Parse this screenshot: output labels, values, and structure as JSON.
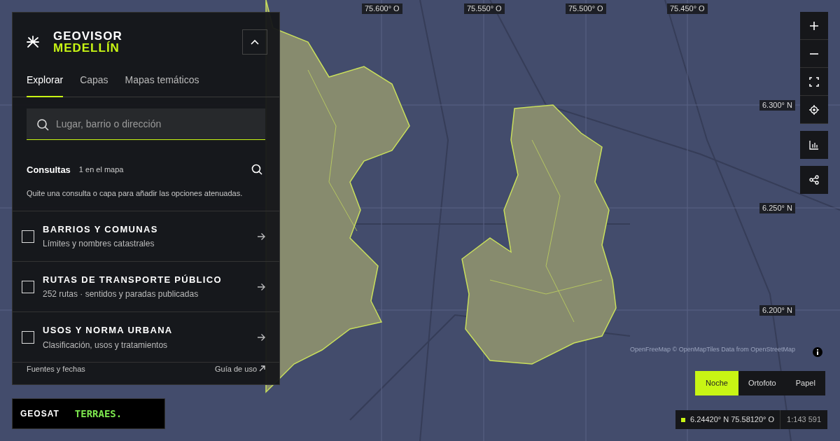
{
  "brand": {
    "title": "GEOVISOR",
    "subtitle": "MEDELLÍN"
  },
  "tabs": [
    {
      "label": "Explorar",
      "selected": true
    },
    {
      "label": "Capas",
      "selected": false
    },
    {
      "label": "Mapas temáticos",
      "selected": false
    }
  ],
  "search": {
    "placeholder": "Lugar, barrio o dirección"
  },
  "queries": {
    "title": "Consultas",
    "count": "1 en el mapa",
    "hint": "Quite una consulta o capa para añadir las opciones atenuadas."
  },
  "layers": [
    {
      "title": "BARRIOS Y COMUNAS",
      "description": "Límites y nombres catastrales",
      "checked": false
    },
    {
      "title": "RUTAS DE TRANSPORTE PÚBLICO",
      "description": "252 rutas · sentidos y paradas publicadas",
      "checked": false
    },
    {
      "title": "USOS Y NORMA URBANA",
      "description": "Clasificación, usos y tratamientos",
      "checked": false
    }
  ],
  "footer": {
    "sources": "Fuentes y fechas",
    "guide": "Guía de uso"
  },
  "partners": [
    "GEOSAT",
    "TERRAES."
  ],
  "map": {
    "longitude_labels": [
      "75.600° O",
      "75.550° O",
      "75.500° O",
      "75.450° O"
    ],
    "latitude_labels": [
      "6.300° N",
      "6.250° N",
      "6.200° N"
    ],
    "attribution": "OpenFreeMap © OpenMapTiles Data from OpenStreetMap"
  },
  "basemaps": [
    {
      "label": "Noche",
      "selected": true
    },
    {
      "label": "Ortofoto",
      "selected": false
    },
    {
      "label": "Papel",
      "selected": false
    }
  ],
  "cursor": {
    "coordinates": "6.24420° N 75.58120° O",
    "scale": "1:143 591"
  }
}
